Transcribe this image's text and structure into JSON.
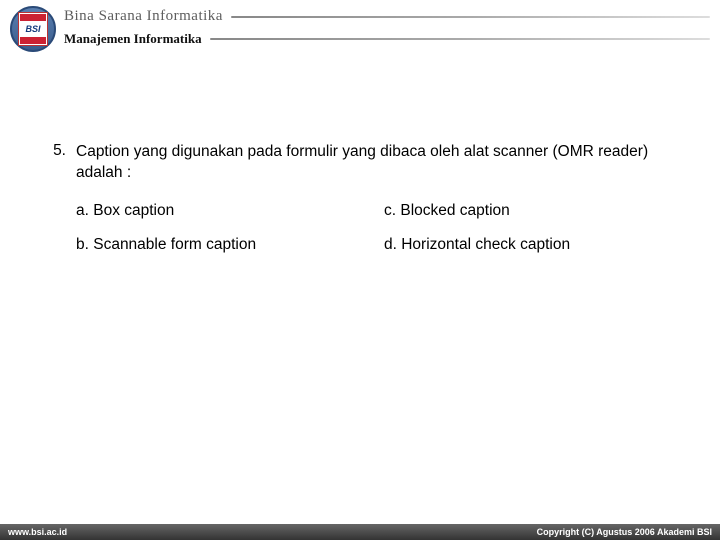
{
  "header": {
    "logo_text": "BSI",
    "org_name": "Bina Sarana Informatika",
    "department": "Manajemen Informatika"
  },
  "question": {
    "number": "5.",
    "text": "Caption yang digunakan pada formulir yang dibaca oleh alat scanner (OMR reader) adalah :",
    "options": {
      "a": "a. Box caption",
      "b": "b. Scannable form caption",
      "c": "c. Blocked caption",
      "d": "d. Horizontal check caption"
    }
  },
  "footer": {
    "url": "www.bsi.ac.id",
    "copyright": "Copyright (C) Agustus 2006 Akademi BSI"
  }
}
